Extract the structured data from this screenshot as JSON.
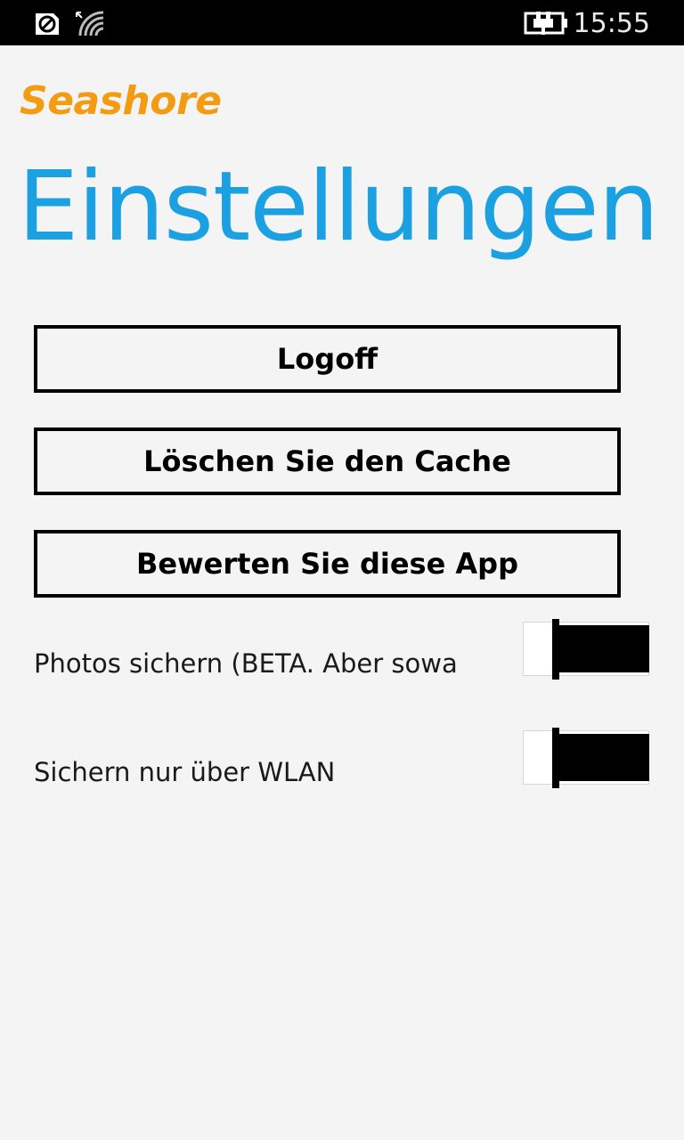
{
  "status_bar": {
    "time": "15:55",
    "icons": [
      "sync-icon",
      "wifi-icon",
      "battery-charging-icon"
    ]
  },
  "app": {
    "name": "Seashore",
    "page_title": "Einstellungen"
  },
  "buttons": {
    "logoff": "Logoff",
    "clear_cache": "Löschen Sie den Cache",
    "rate_app": "Bewerten Sie diese App"
  },
  "settings": [
    {
      "label": "Photos sichern (BETA. Aber sowas v",
      "state": "on"
    },
    {
      "label": "Sichern nur über WLAN",
      "state": "on"
    }
  ],
  "colors": {
    "accent": "#1ba1e2",
    "brand": "#f39c12",
    "background": "#f4f4f4"
  }
}
